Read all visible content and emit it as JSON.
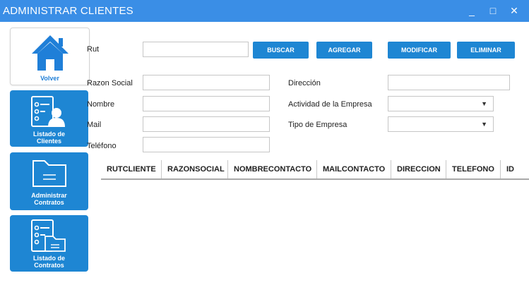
{
  "window": {
    "title": "ADMINISTRAR CLIENTES",
    "minimize": "_",
    "maximize": "□",
    "close": "✕"
  },
  "sidebar": {
    "volver": "Volver",
    "listado_clientes": [
      "Listado de",
      "Clientes"
    ],
    "administrar_contratos": [
      "Administrar",
      "Contratos"
    ],
    "listado_contratos": [
      "Listado de",
      "Contratos"
    ]
  },
  "form": {
    "rut_label": "Rut",
    "rut_value": "",
    "razon_social_label": "Razon Social",
    "razon_social_value": "",
    "nombre_label": "Nombre",
    "nombre_value": "",
    "mail_label": "Mail",
    "mail_value": "",
    "telefono_label": "Teléfono",
    "telefono_value": "",
    "direccion_label": "Dirección",
    "direccion_value": "",
    "actividad_label": "Actividad de la Empresa",
    "actividad_value": "",
    "tipo_label": "Tipo de Empresa",
    "tipo_value": ""
  },
  "actions": {
    "buscar": "BUSCAR",
    "agregar": "AGREGAR",
    "modificar": "MODIFICAR",
    "eliminar": "ELIMINAR"
  },
  "table": {
    "columns": [
      "RUTCLIENTE",
      "RAZONSOCIAL",
      "NOMBRECONTACTO",
      "MAILCONTACTO",
      "DIRECCION",
      "TELEFONO",
      "ID"
    ],
    "rows": []
  },
  "icons": {
    "home": "home-icon",
    "client_list": "client-list-icon",
    "folder": "folder-icon",
    "contract_list": "contract-list-icon",
    "dropdown": "chevron-down-icon"
  },
  "colors": {
    "titlebar": "#3a8ee6",
    "accent": "#1e86d3"
  }
}
